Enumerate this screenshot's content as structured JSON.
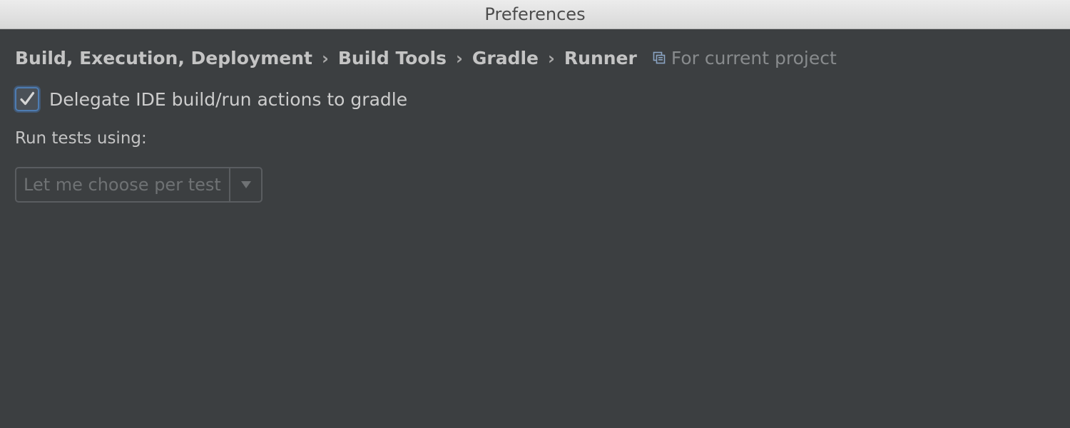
{
  "window": {
    "title": "Preferences"
  },
  "breadcrumb": {
    "items": [
      "Build, Execution, Deployment",
      "Build Tools",
      "Gradle",
      "Runner"
    ],
    "separator": "›",
    "scope_icon": "project-scope-icon",
    "scope_label": "For current project"
  },
  "settings": {
    "delegate": {
      "label": "Delegate IDE build/run actions to gradle",
      "checked": true
    },
    "run_tests": {
      "label": "Run tests using:",
      "selected": "Let me choose per test",
      "enabled": false
    }
  },
  "colors": {
    "background": "#3c3f41",
    "text": "#c4c4c4",
    "muted": "#888b8d",
    "accent": "#4e7cb1"
  }
}
